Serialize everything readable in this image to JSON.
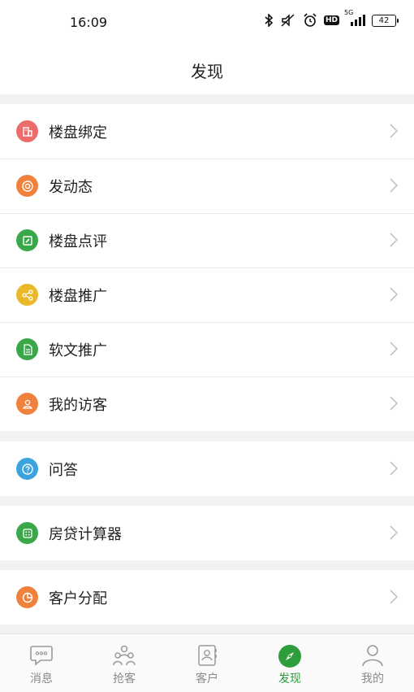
{
  "status": {
    "time": "16:09",
    "network": "5G",
    "battery": "42",
    "hd": "HD"
  },
  "header": {
    "title": "发现"
  },
  "menu_groups": [
    {
      "items": [
        {
          "label": "楼盘绑定",
          "icon": "building-icon",
          "color": "#ec6b6b"
        },
        {
          "label": "发动态",
          "icon": "target-icon",
          "color": "#f0813c"
        },
        {
          "label": "楼盘点评",
          "icon": "edit-icon",
          "color": "#3aa84a"
        },
        {
          "label": "楼盘推广",
          "icon": "share-icon",
          "color": "#e9b92a"
        },
        {
          "label": "软文推广",
          "icon": "document-icon",
          "color": "#3aa84a"
        },
        {
          "label": "我的访客",
          "icon": "user-icon",
          "color": "#f0813c"
        }
      ]
    },
    {
      "items": [
        {
          "label": "问答",
          "icon": "question-icon",
          "color": "#3aa3e0"
        }
      ]
    },
    {
      "items": [
        {
          "label": "房贷计算器",
          "icon": "calculator-icon",
          "color": "#3aa84a"
        }
      ]
    },
    {
      "items": [
        {
          "label": "客户分配",
          "icon": "pie-icon",
          "color": "#f0813c"
        }
      ]
    }
  ],
  "tabs": [
    {
      "label": "消息",
      "icon": "chat-icon",
      "active": false
    },
    {
      "label": "抢客",
      "icon": "people-icon",
      "active": false
    },
    {
      "label": "客户",
      "icon": "contacts-icon",
      "active": false
    },
    {
      "label": "发现",
      "icon": "compass-icon",
      "active": true
    },
    {
      "label": "我的",
      "icon": "profile-icon",
      "active": false
    }
  ]
}
